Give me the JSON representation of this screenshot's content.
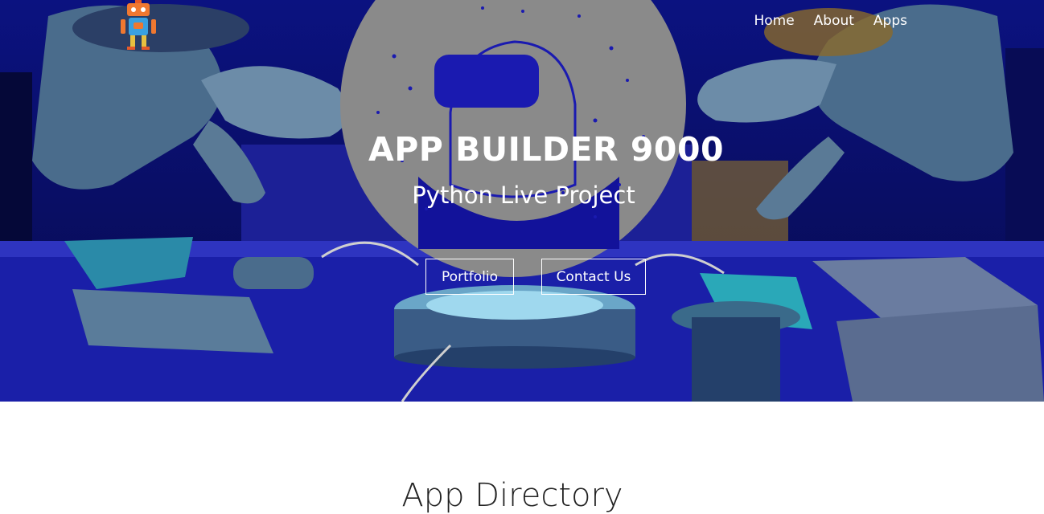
{
  "header": {
    "logo_icon": "robot-logo-icon",
    "nav": [
      {
        "label": "Home"
      },
      {
        "label": "About"
      },
      {
        "label": "Apps"
      }
    ]
  },
  "hero": {
    "title": "APP BUILDER 9000",
    "subtitle": "Python Live Project",
    "buttons": {
      "portfolio": "Portfolio",
      "contact": "Contact Us"
    }
  },
  "directory": {
    "heading": "App Directory"
  },
  "colors": {
    "hero_background": "#0a0f6e",
    "hero_circle": "#8a8a8a",
    "accent_blue": "#1a1ab0",
    "text_light": "#ffffff",
    "text_dark": "#222222"
  }
}
